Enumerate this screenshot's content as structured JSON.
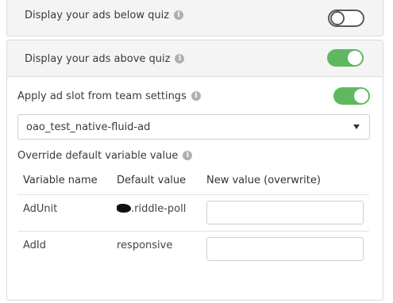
{
  "below_quiz": {
    "label": "Display your ads below quiz",
    "toggle_state": "off"
  },
  "above_quiz": {
    "label": "Display your ads above quiz",
    "toggle_state": "on"
  },
  "team_settings": {
    "label": "Apply ad slot from team settings",
    "toggle_state": "on"
  },
  "ad_slot_select": {
    "selected": "oao_test_native-fluid-ad"
  },
  "override": {
    "label": "Override default variable value"
  },
  "table": {
    "headers": [
      "Variable name",
      "Default value",
      "New value (overwrite)"
    ],
    "rows": [
      {
        "name": "AdUnit",
        "default_suffix": ".riddle-poll",
        "new_value": ""
      },
      {
        "name": "AdId",
        "default": "responsive",
        "new_value": ""
      }
    ]
  },
  "colors": {
    "toggle_on": "#5fb85f",
    "panel_bg": "#f4f4f4",
    "border": "#dcdcdc"
  },
  "icons": [
    "info-icon",
    "chevron-down-icon"
  ]
}
